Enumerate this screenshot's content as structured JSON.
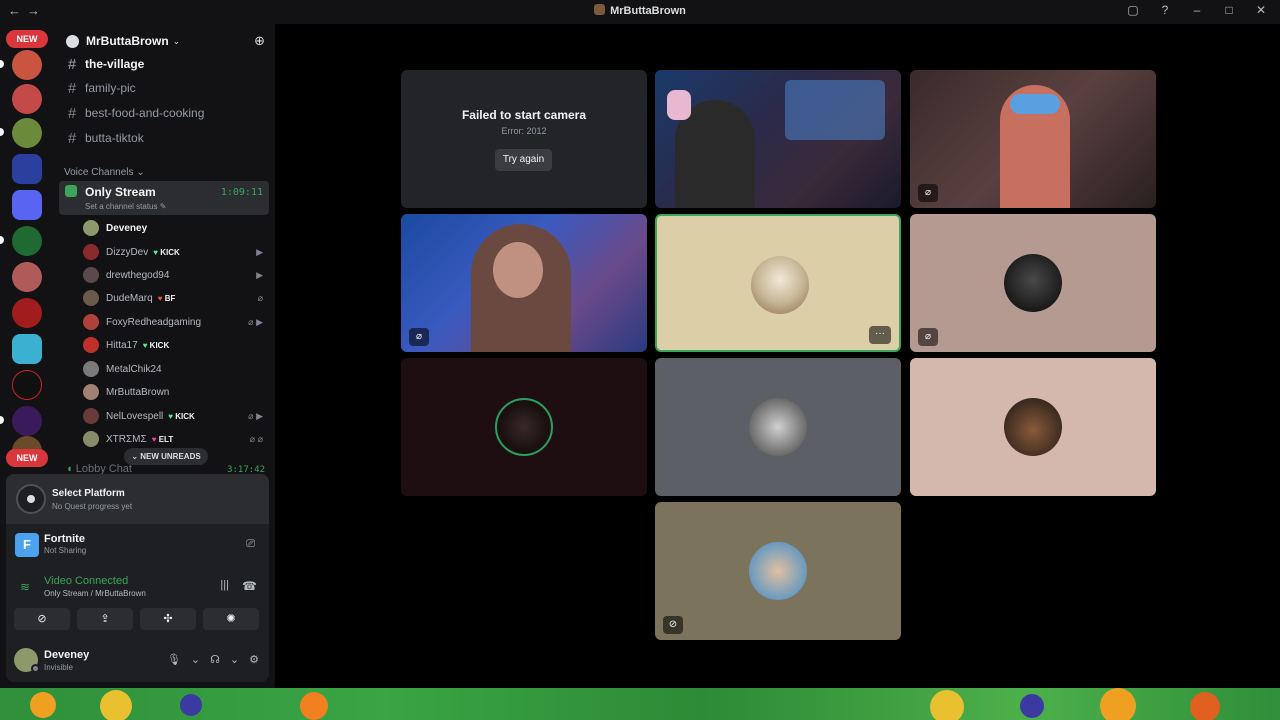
{
  "titlebar": {
    "back_icon": "←",
    "forward_icon": "→",
    "title": "MrButtaBrown"
  },
  "rail": {
    "top_badge": "NEW",
    "bottom_badge": "NEW"
  },
  "server": {
    "name": "MrButtaBrown"
  },
  "channels": [
    {
      "label": "the-village",
      "unread": true
    },
    {
      "label": "family-pic",
      "unread": false
    },
    {
      "label": "best-food-and-cooking",
      "unread": false
    },
    {
      "label": "butta-tiktok",
      "unread": false
    }
  ],
  "voice_category": "Voice Channels",
  "voice_channel": {
    "name": "Only Stream",
    "timer": "1:09:11",
    "status": "Set a channel status ✎"
  },
  "voice_users": [
    {
      "name": "Deveney",
      "tag": "",
      "icons": ""
    },
    {
      "name": "DizzyDev",
      "tag": "KICK",
      "tag_style": "green",
      "icons": "▶"
    },
    {
      "name": "drewthegod94",
      "tag": "",
      "icons": "▶"
    },
    {
      "name": "DudeMarq",
      "tag": "BF",
      "tag_style": "red",
      "icons": "⌀"
    },
    {
      "name": "FoxyRedheadgaming",
      "tag": "",
      "icons": "⌀ ▶"
    },
    {
      "name": "Hitta17",
      "tag": "KICK",
      "tag_style": "green",
      "icons": ""
    },
    {
      "name": "MetalChik24",
      "tag": "",
      "icons": ""
    },
    {
      "name": "MrButtaBrown",
      "tag": "",
      "icons": ""
    },
    {
      "name": "NelLovespell",
      "tag": "KICK",
      "tag_style": "green",
      "icons": "⌀ ▶"
    },
    {
      "name": "XTRΣMΣ",
      "tag": "ELT",
      "tag_style": "pink",
      "icons": "⌀ ⌀"
    }
  ],
  "new_unreads": "⌄ NEW UNREADS",
  "lobby": {
    "name": "Lobby Chat",
    "timer": "3:17:42"
  },
  "quest": {
    "title": "Select Platform",
    "subtitle": "No Quest progress yet"
  },
  "activity": {
    "game_letter": "F",
    "game": "Fortnite",
    "status": "Not Sharing"
  },
  "connection": {
    "title": "Video Connected",
    "subtitle": "Only Stream / MrButtaBrown"
  },
  "user": {
    "name": "Deveney",
    "status": "Invisible"
  },
  "camera_error": {
    "title": "Failed to start camera",
    "error": "Error: 2012",
    "retry": "Try again"
  },
  "colors": {
    "accent_green": "#3ba55c",
    "badge_red": "#da373c",
    "background": "#121214"
  }
}
